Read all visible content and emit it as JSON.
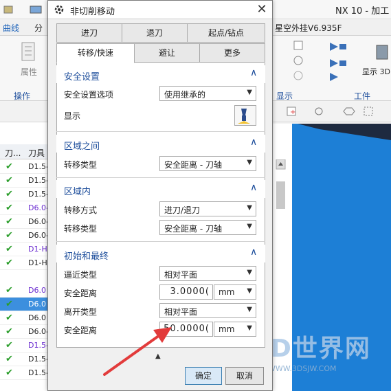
{
  "app": {
    "title": "NX 10 - 加工 -",
    "ribbon_tabs": [
      "曲线",
      "分"
    ],
    "right_title": "星空外挂V6.935F",
    "group_labels": {
      "left1": "属性",
      "left2": "操作",
      "right1": "显示",
      "right2": "工件",
      "display3d": "显示 3D"
    }
  },
  "nav": {
    "columns": [
      "刀...",
      "刀具"
    ],
    "rows": [
      {
        "tool": "D1.5-",
        "purple": false,
        "selected": false
      },
      {
        "tool": "D1.5-",
        "purple": false,
        "selected": false
      },
      {
        "tool": "D1.5-",
        "purple": false,
        "selected": false
      },
      {
        "tool": "D6.0-",
        "purple": true,
        "selected": false
      },
      {
        "tool": "D6.0-",
        "purple": false,
        "selected": false
      },
      {
        "tool": "D6.0-",
        "purple": false,
        "selected": false
      },
      {
        "tool": "D1-H",
        "purple": true,
        "selected": false
      },
      {
        "tool": "D1-H",
        "purple": false,
        "selected": false
      },
      {
        "tool": "D6.0",
        "purple": true,
        "selected": false
      },
      {
        "tool": "D6.0",
        "purple": false,
        "selected": true
      },
      {
        "tool": "D6.0",
        "purple": false,
        "selected": false
      },
      {
        "tool": "D6.0-",
        "purple": false,
        "selected": false
      },
      {
        "tool": "D1.5-",
        "purple": true,
        "selected": false
      },
      {
        "tool": "D1.5-",
        "purple": false,
        "selected": false
      },
      {
        "tool": "D1.5-",
        "purple": false,
        "selected": false
      }
    ]
  },
  "dialog": {
    "title": "非切削移动",
    "tabs_row1": [
      "进刀",
      "退刀",
      "起点/钻点"
    ],
    "tabs_row2": [
      "转移/快速",
      "避让",
      "更多"
    ],
    "active_tab": "转移/快速",
    "sections": {
      "safety": {
        "title": "安全设置",
        "option_label": "安全设置选项",
        "option_value": "使用继承的",
        "show_label": "显示"
      },
      "between_regions": {
        "title": "区域之间",
        "transfer_type_label": "转移类型",
        "transfer_type_value": "安全距离 - 刀轴"
      },
      "within_region": {
        "title": "区域内",
        "transfer_mode_label": "转移方式",
        "transfer_mode_value": "进刀/退刀",
        "transfer_type_label": "转移类型",
        "transfer_type_value": "安全距离 - 刀轴"
      },
      "initial_final": {
        "title": "初始和最终",
        "approach_type_label": "逼近类型",
        "approach_type_value": "相对平面",
        "safe_distance1_label": "安全距离",
        "safe_distance1_value": "3.0000(",
        "safe_distance1_unit": "mm",
        "depart_type_label": "离开类型",
        "depart_type_value": "相对平面",
        "safe_distance2_label": "安全距离",
        "safe_distance2_value": "50.0000(",
        "safe_distance2_unit": "mm"
      }
    },
    "ok_label": "确定",
    "cancel_label": "取消"
  },
  "watermark": {
    "text": "3D世界网",
    "url": "WWW.3DSJW.COM"
  },
  "colors": {
    "accent": "#1f4f9c",
    "annotation": "#e23b3b",
    "viewport": "#1d7fd6"
  }
}
